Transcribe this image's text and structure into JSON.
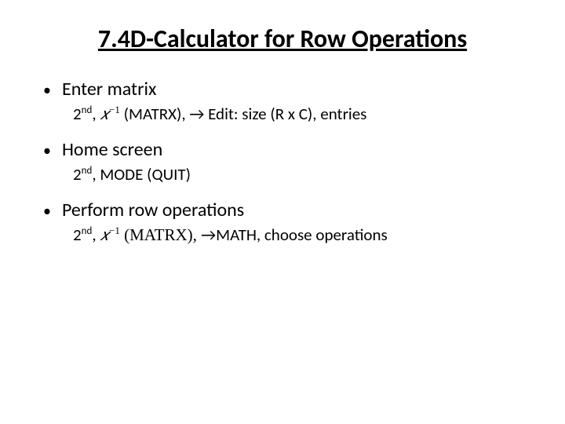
{
  "title": "7.4D-Calculator for Row Operations",
  "bullets": [
    {
      "label": "Enter matrix",
      "sub": {
        "ordinal": "2",
        "ordinal_suffix": "nd",
        "comma1": ", ",
        "math_x": "𝑥",
        "math_exp": "−1",
        "after_math": " (MATRX), → Edit: size (R x C), entries"
      }
    },
    {
      "label": "Home screen",
      "sub": {
        "ordinal": "2",
        "ordinal_suffix": "nd",
        "after": ", MODE (QUIT)"
      }
    },
    {
      "label": "Perform row operations",
      "sub": {
        "ordinal": "2",
        "ordinal_suffix": "nd",
        "comma1": ", ",
        "math_x": "𝑥",
        "math_exp": "−1",
        "matrx_serif": " (MATRX), ",
        "after_arrow": "→MATH, choose operations"
      }
    }
  ]
}
